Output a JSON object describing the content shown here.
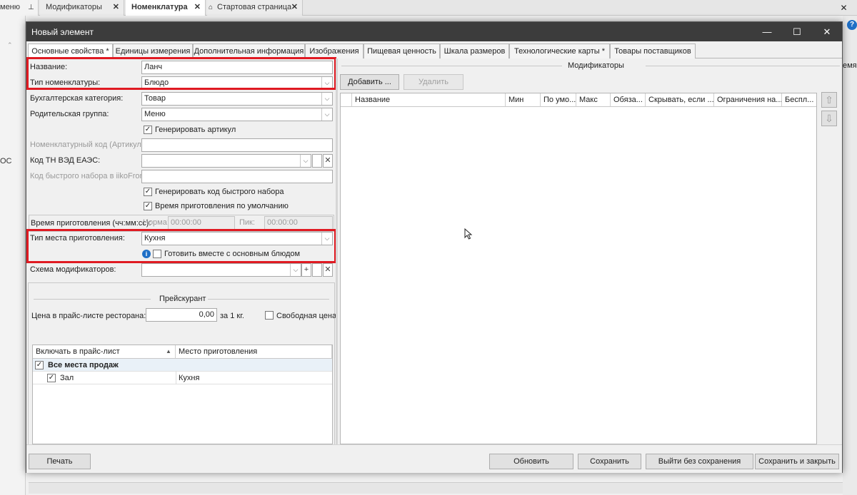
{
  "background": {
    "left_label": "меню",
    "left_side_text": "ОС",
    "right_fragment": "емя г",
    "tabs": [
      {
        "label": "Модификаторы",
        "close": "✕"
      },
      {
        "label": "Номенклатура",
        "close": "✕"
      },
      {
        "label": "Стартовая страница",
        "close": "✕"
      }
    ]
  },
  "dialog": {
    "title": "Новый элемент",
    "controls": {
      "minimize": "—",
      "maximize": "☐",
      "close": "✕"
    },
    "tabs": [
      "Основные свойства *",
      "Единицы измерения",
      "Дополнительная информация",
      "Изображения",
      "Пищевая ценность",
      "Шкала размеров",
      "Технологические карты *",
      "Товары поставщиков"
    ]
  },
  "form": {
    "name_label": "Название:",
    "name_value": "Ланч",
    "type_label": "Тип номенклатуры:",
    "type_value": "Блюдо",
    "acct_label": "Бухгалтерская категория:",
    "acct_value": "Товар",
    "parent_label": "Родительская группа:",
    "parent_value": "Меню",
    "gen_article_label": "Генерировать артикул",
    "gen_article_checked": "✓",
    "code_label": "Номенклатурный код (Артикул):",
    "code_value": "",
    "tnved_label": "Код ТН ВЭД ЕАЭС:",
    "tnved_value": "",
    "quick_label": "Код быстрого набора в iikoFront:",
    "quick_value": "",
    "gen_quick_label": "Генерировать код быстрого набора",
    "gen_quick_checked": "✓",
    "default_time_label": "Время приготовления по умолчанию",
    "default_time_checked": "✓",
    "cook_time_label": "Время приготовления (чч:мм:сс):",
    "norm_label": "Норма:",
    "norm_value": "00:00:00",
    "peak_label": "Пик:",
    "peak_value": "00:00:00",
    "place_type_label": "Тип места приготовления:",
    "place_type_value": "Кухня",
    "cook_with_main_label": "Готовить вместе с основным блюдом",
    "info_icon": "i",
    "modifier_schema_label": "Схема модификаторов:",
    "modifier_schema_value": "",
    "dropdown_arrow": "⌵",
    "plus": "+",
    "clear": "✕"
  },
  "price": {
    "title": "Прейскурант",
    "price_label": "Цена в прайс-листе ресторана:",
    "price_value": "0,00",
    "per_unit": "за 1 кг.",
    "free_price_label": "Свободная цена",
    "table": {
      "headers": [
        "Включать в прайс-лист",
        "Место приготовления"
      ],
      "sort_arrow": "▲",
      "group_row": {
        "label": "Все места продаж",
        "checked": "✓"
      },
      "rows": [
        {
          "label": "Зал",
          "place": "Кухня",
          "checked": "✓"
        }
      ]
    }
  },
  "modifiers": {
    "title": "Модификаторы",
    "add_button": "Добавить ...",
    "delete_button": "Удалить",
    "headers": [
      "Название",
      "Мин",
      "По умо...",
      "Макс",
      "Обяза...",
      "Скрывать, если ...",
      "Ограничения на...",
      "Беспл..."
    ],
    "up_arrow": "⇧",
    "down_arrow": "⇩"
  },
  "footer": {
    "print": "Печать",
    "update": "Обновить",
    "save": "Сохранить",
    "exit_no_save": "Выйти без сохранения",
    "save_close": "Сохранить и закрыть"
  }
}
